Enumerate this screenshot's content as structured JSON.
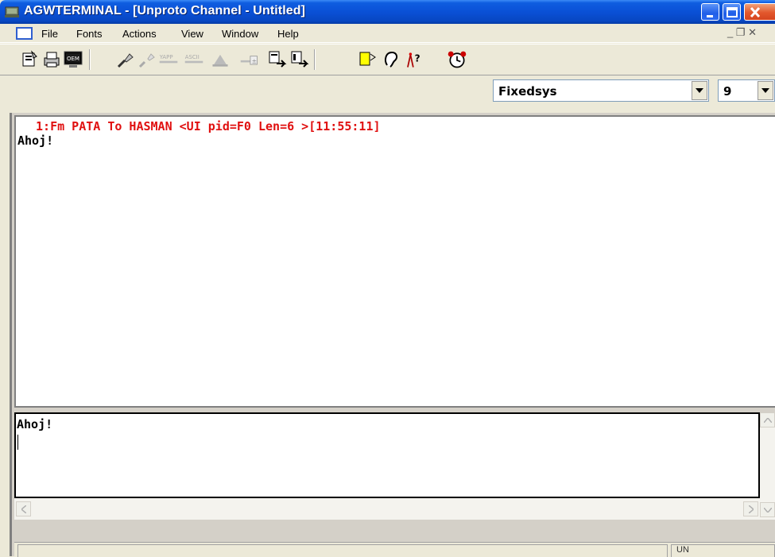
{
  "window": {
    "title": "AGWTERMINAL - [Unproto Channel - Untitled]",
    "controls": {
      "minimize": "_",
      "maximize": "□",
      "close": "✕"
    }
  },
  "menu": {
    "items": [
      "File",
      "Fonts",
      "Actions",
      "View",
      "Window",
      "Help"
    ],
    "mdi_controls": "_ ❐ ✕"
  },
  "toolbar": {
    "oem_label": "OEM",
    "yapp_label": "YAPP",
    "ascii_label": "ASCII",
    "font_select": {
      "value": "Fixedsys"
    },
    "size_select": {
      "value": "9"
    }
  },
  "output": {
    "header_line": " 1:Fm PATA To HASMAN <UI pid=F0 Len=6 >[11:55:11]",
    "text": "Ahoj!"
  },
  "input": {
    "text": "Ahoj!"
  },
  "status": {
    "mode": "UN"
  },
  "colors": {
    "titlebar": "#0a50d6",
    "header_text": "#e01010",
    "close_button": "#e2572c"
  }
}
